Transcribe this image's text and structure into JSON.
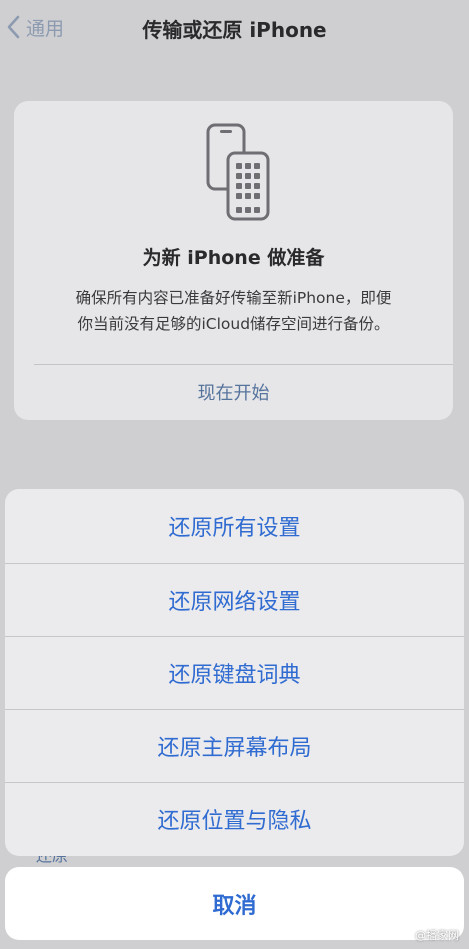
{
  "navbar": {
    "back_label": "通用",
    "title": "传输或还原 iPhone"
  },
  "prepare_card": {
    "title": "为新 iPhone 做准备",
    "description_line1": "确保所有内容已准备好传输至新iPhone，即便",
    "description_line2": "你当前没有足够的iCloud储存空间进行备份。",
    "action_label": "现在开始",
    "icon": "two-phones-icon"
  },
  "background_partial_text": "还原",
  "action_sheet": {
    "items": [
      {
        "label": "还原所有设置"
      },
      {
        "label": "还原网络设置"
      },
      {
        "label": "还原键盘词典"
      },
      {
        "label": "还原主屏幕布局"
      },
      {
        "label": "还原位置与隐私"
      }
    ],
    "cancel_label": "取消"
  },
  "watermark": "@播家网",
  "colors": {
    "accent": "#2f6bd1",
    "dim_accent": "#56739c",
    "background": "#cfcfd2"
  }
}
